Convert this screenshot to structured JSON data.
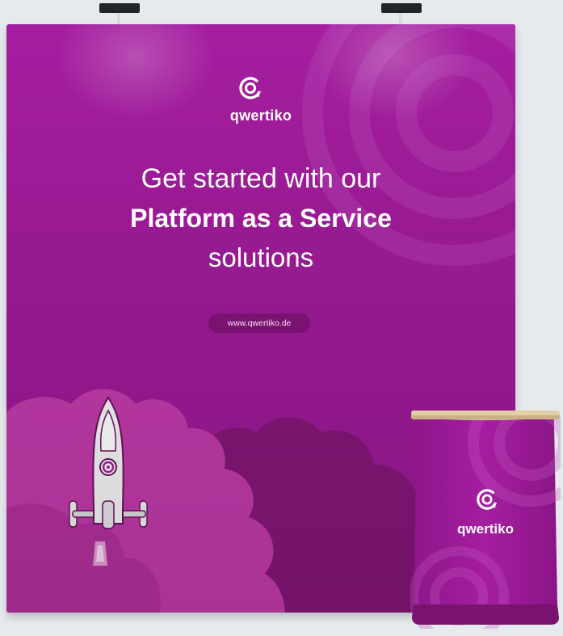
{
  "booth": {
    "brand_name": "qwertiko",
    "headline": {
      "line1": "Get started with our",
      "line2": "Platform as a Service",
      "line3": "solutions"
    },
    "website_url": "www.qwertiko.de"
  },
  "counter": {
    "brand_name": "qwertiko"
  },
  "colors": {
    "background": "#e6e9ee",
    "booth_purple": "#9d1a96",
    "cloud_pink": "#c03aa8",
    "cloud_dark": "#7a1270",
    "counter_top_wood": "#d8c49a"
  },
  "icons": [
    "qwertiko-logo-icon",
    "rocket-icon",
    "spotlight-lamp-icon"
  ]
}
